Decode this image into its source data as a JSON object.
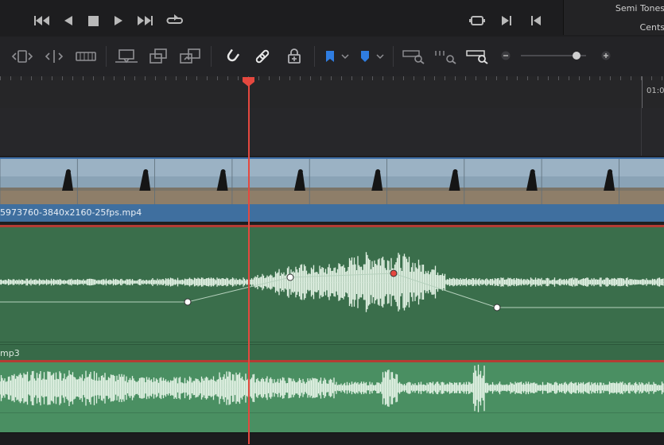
{
  "header": {
    "right_panel_line1": "Semi Tones",
    "right_panel_line2": "Cents"
  },
  "transport": {
    "buttons": [
      "skip-back-icon",
      "step-back-icon",
      "stop-icon",
      "play-icon",
      "skip-forward-icon",
      "loop-icon"
    ],
    "right_buttons": [
      "match-frame-icon",
      "next-edit-icon",
      "prev-edit-icon"
    ]
  },
  "toolbar": {
    "icons": [
      "trim-mode-icon",
      "dynamic-trim-icon",
      "blade-icon",
      "insert-clip-icon",
      "overwrite-clip-icon",
      "replace-clip-icon",
      "snapping-icon",
      "linked-selection-icon",
      "position-lock-icon",
      "flag-icon",
      "marker-icon",
      "zoom-full-icon",
      "zoom-detail-icon",
      "zoom-custom-icon",
      "zoom-out-icon",
      "zoom-in-icon"
    ],
    "flag_color": "#2f7de1",
    "marker_color": "#2f7de1",
    "zoom_slider_value": 0.85
  },
  "ruler": {
    "timecode_label": "01:0"
  },
  "tracks": {
    "video": {
      "clip_name": "5973760-3840x2160-25fps.mp4",
      "color": "#3f6f9f"
    },
    "audio1": {
      "clip_name": "mp3",
      "color": "#3a6e4b"
    },
    "audio2": {
      "color": "#4a8f62"
    }
  },
  "colors": {
    "playhead": "#e5483f",
    "track_top_border": "#b43c34"
  }
}
